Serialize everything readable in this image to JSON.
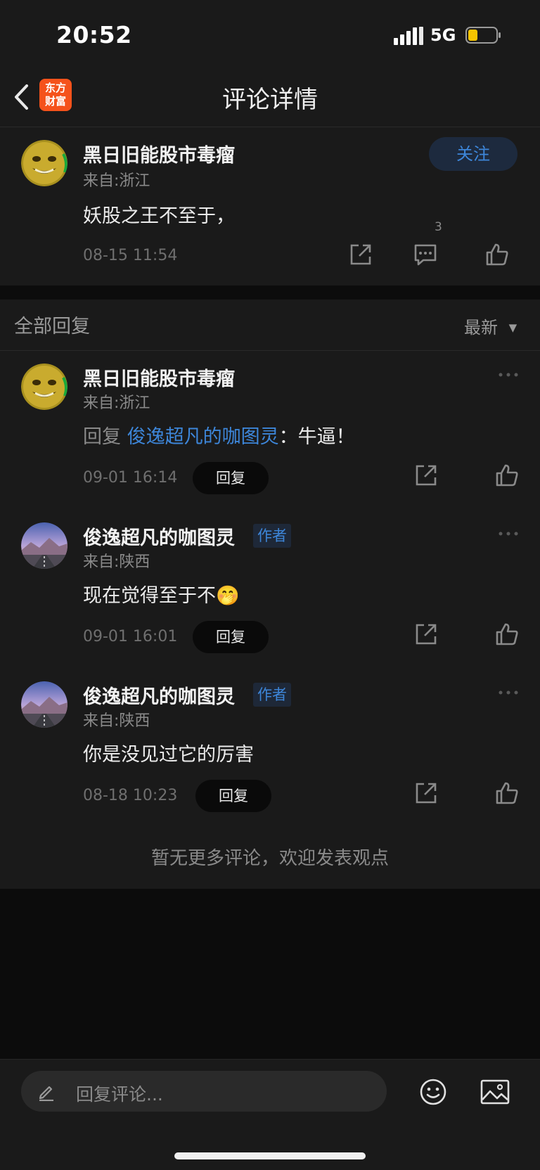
{
  "status_bar": {
    "time": "20:52",
    "network": "5G"
  },
  "nav": {
    "logo_line1": "东方",
    "logo_line2": "财富",
    "title": "评论详情"
  },
  "post": {
    "username": "黑日旧能股市毒瘤",
    "location": "来自:浙江",
    "content": "妖股之王不至于，",
    "date": "08-15 11:54",
    "follow_label": "关注",
    "comment_count": "3"
  },
  "replies_header": {
    "title": "全部回复",
    "sort_label": "最新"
  },
  "replies": [
    {
      "username": "黑日旧能股市毒瘤",
      "location": "来自:浙江",
      "reply_prefix": "回复",
      "reply_to": "俊逸超凡的咖图灵",
      "reply_text": "：牛逼！",
      "date": "09-01 16:14",
      "reply_label": "回复"
    },
    {
      "username": "俊逸超凡的咖图灵",
      "badge": "作者",
      "location": "来自:陕西",
      "content": "现在觉得至于不",
      "emoji": "🤭",
      "date": "09-01 16:01",
      "reply_label": "回复"
    },
    {
      "username": "俊逸超凡的咖图灵",
      "badge": "作者",
      "location": "来自:陕西",
      "content": "你是没见过它的厉害",
      "date": "08-18 10:23",
      "reply_label": "回复"
    }
  ],
  "footer_note": "暂无更多评论，欢迎发表观点",
  "bottom_bar": {
    "input_placeholder": "回复评论..."
  },
  "colors": {
    "accent_blue": "#3d86d9",
    "logo_orange": "#f5521b",
    "background": "#1a1a1a",
    "battery_yellow": "#f5c400"
  }
}
